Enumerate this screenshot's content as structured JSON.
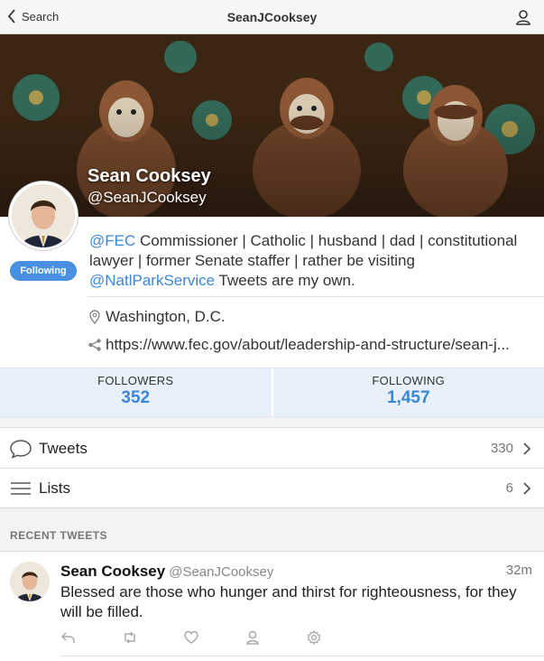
{
  "nav": {
    "back_label": "Search",
    "title": "SeanJCooksey"
  },
  "profile": {
    "name": "Sean Cooksey",
    "handle": "@SeanJCooksey",
    "follow_label": "Following",
    "bio": {
      "mention1": "@FEC",
      "text1": " Commissioner | Catholic | husband | dad | constitutional lawyer | former Senate staffer | rather be visiting ",
      "mention2": "@NatlParkService",
      "text2": "  Tweets are my own."
    },
    "location": "Washington, D.C.",
    "url": "https://www.fec.gov/about/leadership-and-structure/sean-j..."
  },
  "stats": {
    "followers_label": "FOLLOWERS",
    "followers_value": "352",
    "following_label": "FOLLOWING",
    "following_value": "1,457"
  },
  "rows": {
    "tweets_label": "Tweets",
    "tweets_count": "330",
    "lists_label": "Lists",
    "lists_count": "6"
  },
  "recent": {
    "header": "RECENT TWEETS",
    "tweet": {
      "name": "Sean Cooksey",
      "handle": "@SeanJCooksey",
      "time": "32m",
      "text": "Blessed are those who hunger and thirst for righteousness, for they will be filled."
    }
  },
  "icons": [
    "chevron-left-icon",
    "user-icon",
    "location-pin-icon",
    "share-link-icon",
    "speech-bubble-icon",
    "list-icon",
    "chevron-right-icon",
    "reply-icon",
    "retweet-icon",
    "heart-icon",
    "user-icon",
    "gear-icon"
  ],
  "colors": {
    "accent": "#3a87d6",
    "follow_button": "#4a90e2",
    "stats_bg": "#e8f0fa"
  }
}
